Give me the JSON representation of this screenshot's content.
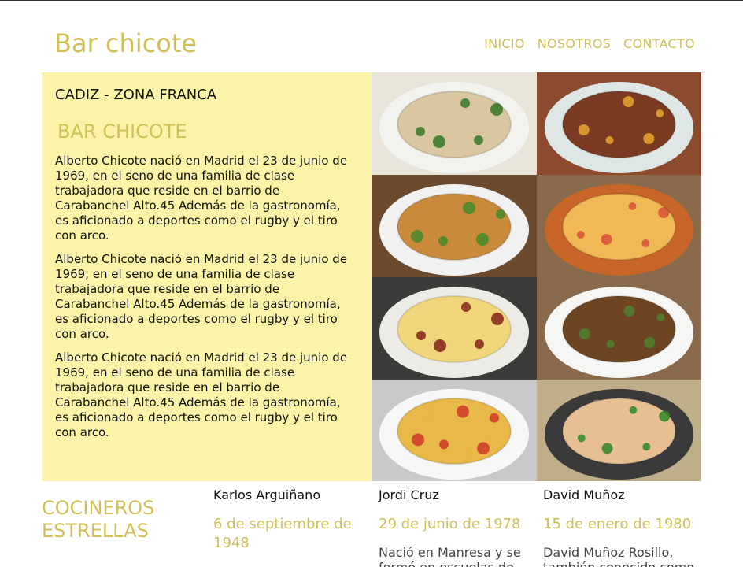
{
  "header": {
    "brand": "Bar chicote",
    "nav": [
      "INICIO",
      "NOSOTROS",
      "CONTACTO"
    ]
  },
  "hero": {
    "location": "CADIZ - ZONA FRANCA",
    "subtitle": "BAR CHICOTE",
    "paragraphs": [
      "Alberto Chicote nació en Madrid el 23 de junio de 1969, en el seno de una familia de clase trabajadora que reside en el barrio de Carabanchel Alto.45 Además de la gastronomía, es aficionado a deportes como el rugby y el tiro con arco.",
      "Alberto Chicote nació en Madrid el 23 de junio de 1969, en el seno de una familia de clase trabajadora que reside en el barrio de Carabanchel Alto.45 Además de la gastronomía, es aficionado a deportes como el rugby y el tiro con arco.",
      "Alberto Chicote nació en Madrid el 23 de junio de 1969, en el seno de una familia de clase trabajadora que reside en el barrio de Carabanchel Alto.45 Además de la gastronomía, es aficionado a deportes como el rugby y el tiro con arco."
    ]
  },
  "gallery": [
    {
      "icon": "mushroom-salad-image",
      "plate": "#f2f2ee",
      "food": "#d8c7a0",
      "accent": "#3f7a2a",
      "bg": "#e9e4da"
    },
    {
      "icon": "meat-pasta-image",
      "plate": "#dfe6e6",
      "food": "#7a3b22",
      "accent": "#e0a030",
      "bg": "#8c4a2e"
    },
    {
      "icon": "burger-image",
      "plate": "#f1f1f1",
      "food": "#c98a3c",
      "accent": "#4f8a2a",
      "bg": "#6b4a2d"
    },
    {
      "icon": "gratin-bowl-image",
      "plate": "#c76628",
      "food": "#f0b955",
      "accent": "#d8573a",
      "bg": "#8a6a4d"
    },
    {
      "icon": "fried-eggs-chorizo-image",
      "plate": "#ecebe6",
      "food": "#f1d57a",
      "accent": "#8a2c1e",
      "bg": "#3d3a3a"
    },
    {
      "icon": "snails-image",
      "plate": "#f6f6f4",
      "food": "#6d4523",
      "accent": "#4f7d2c",
      "bg": "#8a6a4d"
    },
    {
      "icon": "rice-dish-image",
      "plate": "#f7f7f7",
      "food": "#e8b848",
      "accent": "#d0412a",
      "bg": "#c9c9c9"
    },
    {
      "icon": "chicken-salad-image",
      "plate": "#3a3a3a",
      "food": "#e6c092",
      "accent": "#3c8a2e",
      "bg": "#bfae8a"
    }
  ],
  "chefs": {
    "title": "COCINEROS ESTRELLAS",
    "items": [
      {
        "name": "Karlos Arguiñano",
        "date": "6 de septiembre de 1948",
        "bio": ""
      },
      {
        "name": "Jordi Cruz",
        "date": "29 de junio de 1978",
        "bio": "Nació en Manresa y se formó en escuelas de"
      },
      {
        "name": "David Muñoz",
        "date": "15 de enero de 1980",
        "bio": "David Muñoz Rosillo, también conocido como"
      }
    ]
  }
}
